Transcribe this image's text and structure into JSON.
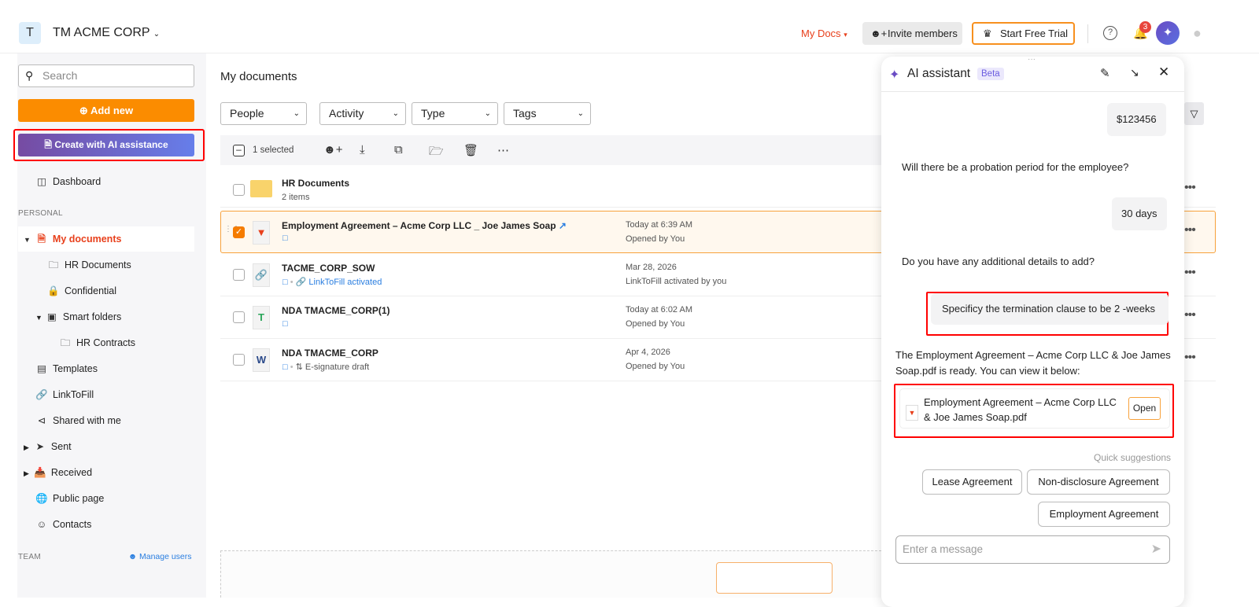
{
  "header": {
    "org_initial": "T",
    "org_name": "TM ACME CORP",
    "my_docs": "My Docs",
    "invite": "Invite members",
    "trial": "Start Free Trial",
    "notif_count": "3"
  },
  "sidebar": {
    "search_placeholder": "Search",
    "add_new": "Add new",
    "create_ai": "Create with AI assistance",
    "dashboard": "Dashboard",
    "personal": "PERSONAL",
    "my_documents": "My documents",
    "hr_documents": "HR Documents",
    "confidential": "Confidential",
    "smart_folders": "Smart folders",
    "hr_contracts": "HR Contracts",
    "templates": "Templates",
    "linktofill": "LinkToFill",
    "shared": "Shared with me",
    "sent": "Sent",
    "received": "Received",
    "public_page": "Public page",
    "contacts": "Contacts",
    "team": "TEAM",
    "manage_users": "Manage users"
  },
  "main": {
    "title": "My documents",
    "filters": [
      "People",
      "Activity",
      "Type",
      "Tags"
    ],
    "selected": "1 selected",
    "folder": {
      "name": "HR Documents",
      "sub": "2 items"
    },
    "rows": [
      {
        "name": "Employment Agreement – Acme Corp LLC _ Joe James Soap",
        "date": "Today at 6:39 AM",
        "status": "Opened by You"
      },
      {
        "name": "TACME_CORP_SOW",
        "tag": "LinkToFill activated",
        "date": "Mar 28, 2026",
        "status": "LinkToFill activated by you"
      },
      {
        "name": "NDA TMACME_CORP(1)",
        "date": "Today at 6:02 AM",
        "status": "Opened by You"
      },
      {
        "name": "NDA TMACME_CORP",
        "tag": "E-signature draft",
        "date": "Apr 4, 2026",
        "status": "Opened by You"
      }
    ]
  },
  "assistant": {
    "title": "AI assistant",
    "beta": "Beta",
    "m1": "$123456",
    "m2": "Will there be a probation period for the employee?",
    "m3": "30 days",
    "m4": "Do you have any additional details to add?",
    "m5": "Specificy the termination clause to be 2 -weeks",
    "m6": "The Employment Agreement – Acme Corp LLC & Joe James Soap.pdf is ready. You can view it below:",
    "file": "Employment Agreement – Acme Corp LLC & Joe James Soap.pdf",
    "open": "Open",
    "quick": "Quick suggestions",
    "chips": [
      "Lease Agreement",
      "Non-disclosure Agreement",
      "Employment Agreement"
    ],
    "placeholder": "Enter a message"
  }
}
